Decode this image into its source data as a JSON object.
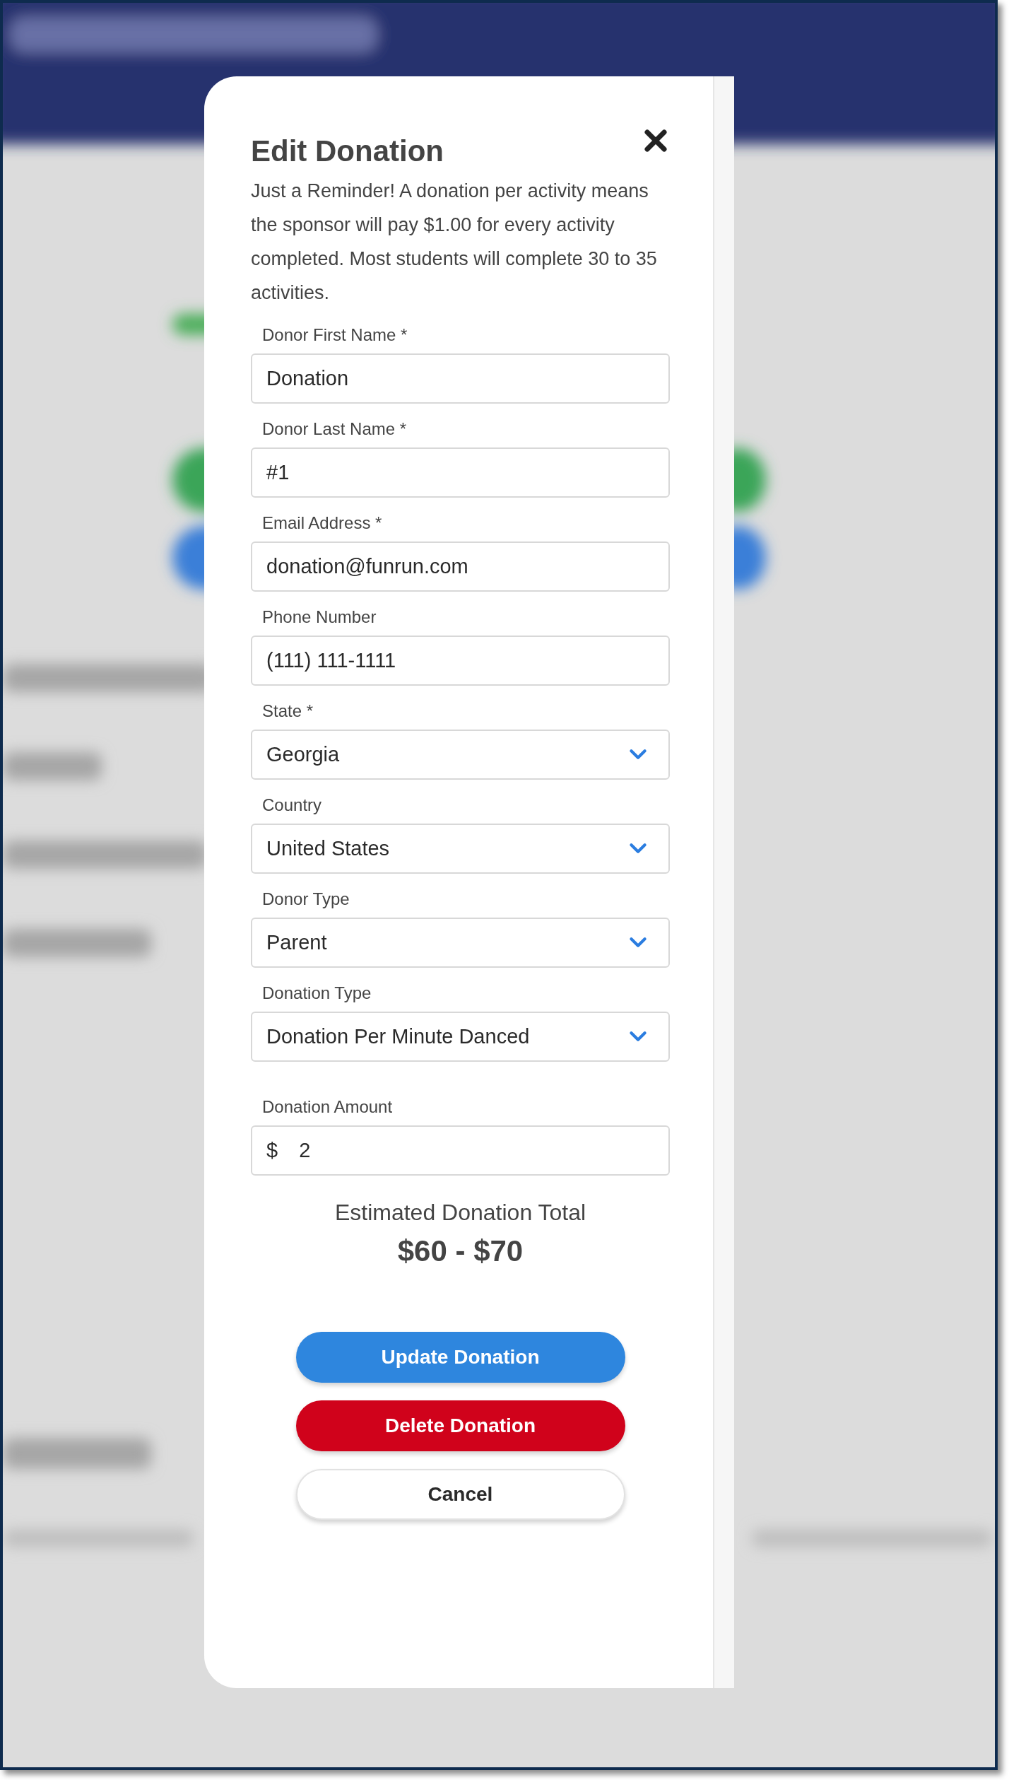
{
  "dialog": {
    "title": "Edit Donation",
    "reminder": "Just a Reminder! A donation per activity means the sponsor will pay $1.00 for every activity completed. Most students will complete 30 to 35 activities.",
    "fields": [
      {
        "label": "Donor First Name *",
        "kind": "text",
        "value": "Donation"
      },
      {
        "label": "Donor Last Name *",
        "kind": "text",
        "value": "#1"
      },
      {
        "label": "Email Address *",
        "kind": "text",
        "value": "donation@funrun.com"
      },
      {
        "label": "Phone Number",
        "kind": "text",
        "value": "(111) 111-1111"
      },
      {
        "label": "State *",
        "kind": "select",
        "value": "Georgia"
      },
      {
        "label": "Country",
        "kind": "select",
        "value": "United States"
      },
      {
        "label": "Donor Type",
        "kind": "select",
        "value": "Parent"
      },
      {
        "label": "Donation Type",
        "kind": "select",
        "value": "Donation Per Minute Danced"
      },
      {
        "label": "Donation Amount",
        "kind": "currency",
        "prefix": "$",
        "value": "2"
      }
    ],
    "estimate": {
      "label": "Estimated Donation Total",
      "value": "$60 - $70"
    },
    "buttons": [
      {
        "label": "Update Donation",
        "kind": "primary"
      },
      {
        "label": "Delete Donation",
        "kind": "danger"
      },
      {
        "label": "Cancel",
        "kind": "plain"
      }
    ]
  }
}
